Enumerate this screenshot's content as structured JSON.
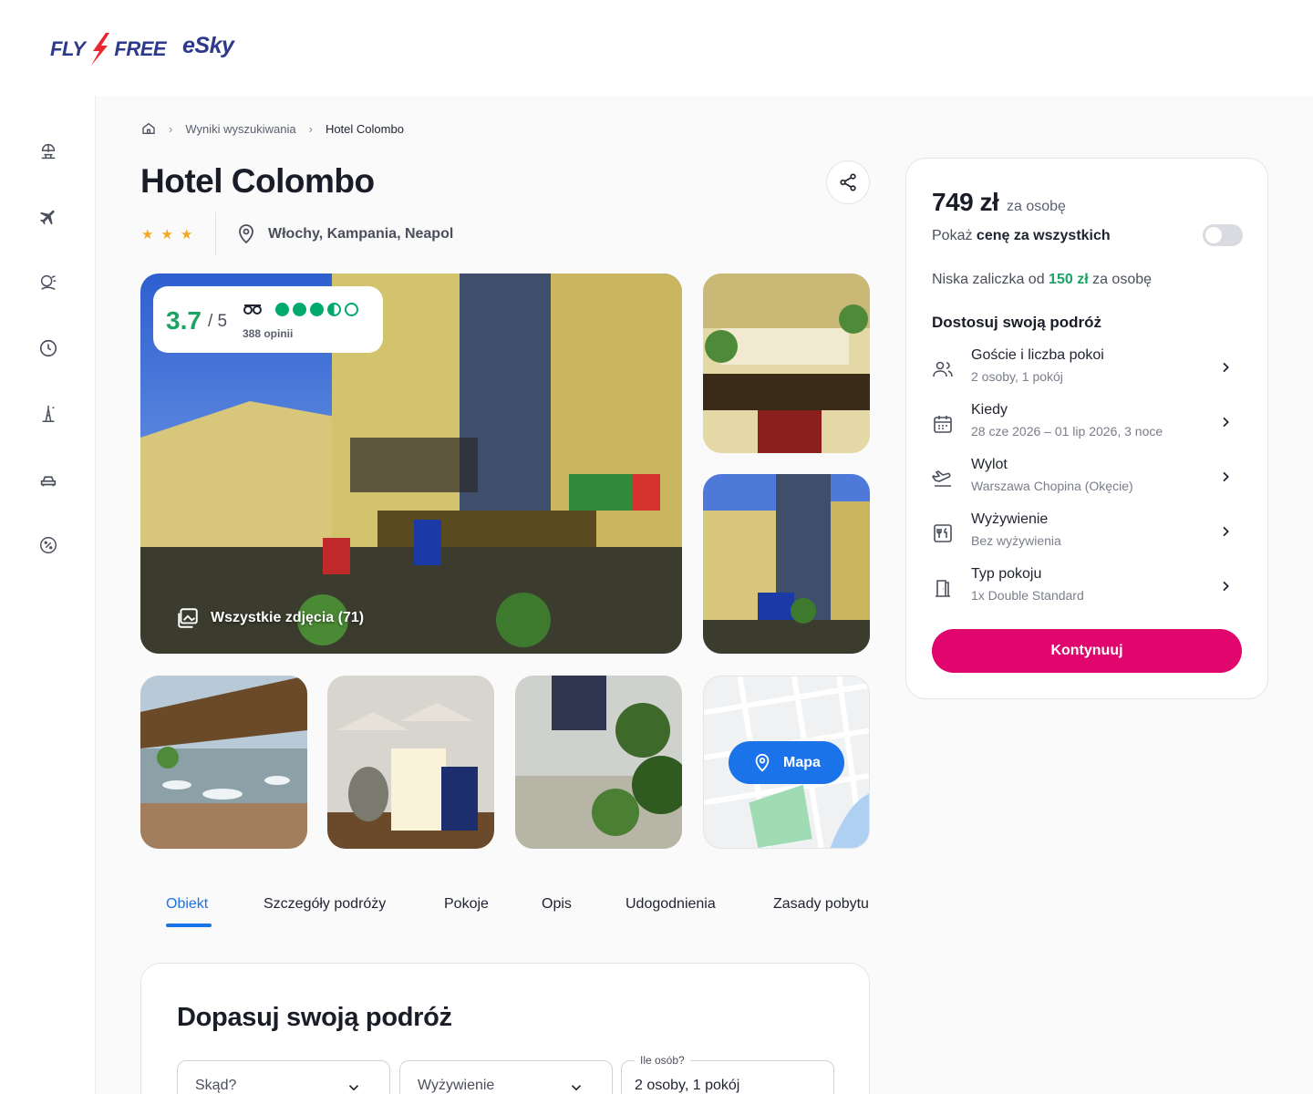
{
  "header": {
    "logo_flyfree_left": "FLY",
    "logo_flyfree_right": "FREE",
    "logo_esky": "eSky"
  },
  "rail": {
    "items": [
      {
        "icon": "beach-umbrella-icon"
      },
      {
        "icon": "plane-icon"
      },
      {
        "icon": "sun-vacation-icon"
      },
      {
        "icon": "clock-icon"
      },
      {
        "icon": "city-trip-icon"
      },
      {
        "icon": "car-icon"
      },
      {
        "icon": "discount-icon"
      }
    ]
  },
  "breadcrumb": {
    "home_icon": "home-icon",
    "items": [
      "Wyniki wyszukiwania",
      "Hotel Colombo"
    ]
  },
  "hotel": {
    "name": "Hotel Colombo",
    "stars": 3,
    "location": "Włochy, Kampania, Neapol",
    "rating": {
      "score": "3.7",
      "out_of": "/ 5",
      "bubbles": 3.5,
      "reviews": "388 opinii"
    },
    "all_photos_label": "Wszystkie zdjęcia (71)",
    "map_label": "Mapa"
  },
  "tabs": [
    {
      "label": "Obiekt",
      "active": true
    },
    {
      "label": "Szczegóły podróży",
      "active": false
    },
    {
      "label": "Pokoje",
      "active": false
    },
    {
      "label": "Opis",
      "active": false
    },
    {
      "label": "Udogodnienia",
      "active": false
    },
    {
      "label": "Zasady pobytu",
      "active": false
    }
  ],
  "fit": {
    "title": "Dopasuj swoją podróż",
    "from_placeholder": "Skąd?",
    "board_placeholder": "Wyżywienie",
    "guests_label": "Ile osób?",
    "guests_value": "2 osoby, 1 pokój"
  },
  "price": {
    "amount": "749 zł",
    "per": "za osobę",
    "toggle_prefix": "Pokaż ",
    "toggle_bold": "cenę za wszystkich",
    "toggle_on": false,
    "deposit_prefix": "Niska zaliczka od ",
    "deposit_amount": "150 zł",
    "deposit_suffix": " za osobę",
    "section_title": "Dostosuj swoją podróż",
    "rows": [
      {
        "icon": "guests-icon",
        "label": "Goście i liczba pokoi",
        "sub": "2 osoby, 1 pokój"
      },
      {
        "icon": "calendar-icon",
        "label": "Kiedy",
        "sub": "28 cze 2026 – 01 lip 2026, 3 noce"
      },
      {
        "icon": "departure-icon",
        "label": "Wylot",
        "sub": "Warszawa Chopina (Okęcie)"
      },
      {
        "icon": "meal-icon",
        "label": "Wyżywienie",
        "sub": "Bez wyżywienia"
      },
      {
        "icon": "room-door-icon",
        "label": "Typ pokoju",
        "sub": "1x Double Standard"
      }
    ],
    "cta": "Kontynuuj"
  },
  "colors": {
    "accent_blue": "#1a73e8",
    "cta_pink": "#e0066d",
    "rating_green": "#1ba363",
    "star_orange": "#f5a623",
    "brand_navy": "#2d3a8c"
  }
}
